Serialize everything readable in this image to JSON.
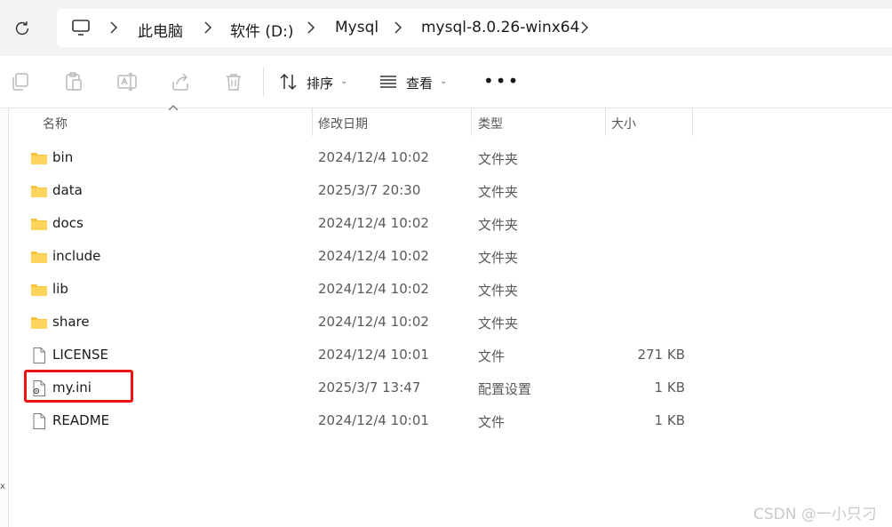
{
  "address": {
    "breadcrumbs": [
      "此电脑",
      "软件 (D:)",
      "Mysql",
      "mysql-8.0.26-winx64"
    ]
  },
  "toolbar": {
    "sort_label": "排序",
    "view_label": "查看",
    "more_label": "•••",
    "icons": [
      "copy-icon",
      "paste-icon",
      "rename-icon",
      "share-icon",
      "delete-icon"
    ]
  },
  "columns": {
    "name": "名称",
    "date": "修改日期",
    "type": "类型",
    "size": "大小"
  },
  "files": [
    {
      "name": "bin",
      "date": "2024/12/4 10:02",
      "type": "文件夹",
      "size": "",
      "kind": "folder"
    },
    {
      "name": "data",
      "date": "2025/3/7 20:30",
      "type": "文件夹",
      "size": "",
      "kind": "folder"
    },
    {
      "name": "docs",
      "date": "2024/12/4 10:02",
      "type": "文件夹",
      "size": "",
      "kind": "folder"
    },
    {
      "name": "include",
      "date": "2024/12/4 10:02",
      "type": "文件夹",
      "size": "",
      "kind": "folder"
    },
    {
      "name": "lib",
      "date": "2024/12/4 10:02",
      "type": "文件夹",
      "size": "",
      "kind": "folder"
    },
    {
      "name": "share",
      "date": "2024/12/4 10:02",
      "type": "文件夹",
      "size": "",
      "kind": "folder"
    },
    {
      "name": "LICENSE",
      "date": "2024/12/4 10:01",
      "type": "文件",
      "size": "271 KB",
      "kind": "file"
    },
    {
      "name": "my.ini",
      "date": "2025/3/7 13:47",
      "type": "配置设置",
      "size": "1 KB",
      "kind": "ini"
    },
    {
      "name": "README",
      "date": "2024/12/4 10:01",
      "type": "文件",
      "size": "1 KB",
      "kind": "file"
    }
  ],
  "left_strip": {
    "mark": "x"
  },
  "watermark": "CSDN @一小只刁",
  "colors": {
    "folder": "#f8c43c",
    "highlight": "#ee1111",
    "accent": "#0067c0"
  }
}
